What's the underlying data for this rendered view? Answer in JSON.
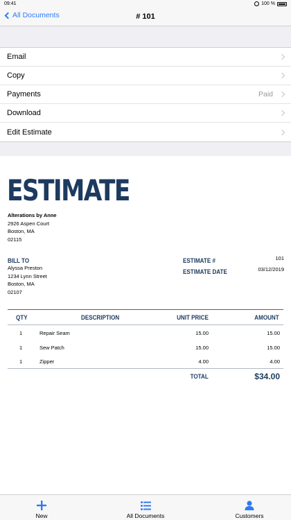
{
  "status_bar": {
    "time": "09:41",
    "battery": "100 %"
  },
  "nav": {
    "back_label": "All Documents",
    "title": "# 101"
  },
  "menu": [
    {
      "label": "Email",
      "value": ""
    },
    {
      "label": "Copy",
      "value": ""
    },
    {
      "label": "Payments",
      "value": "Paid"
    },
    {
      "label": "Download",
      "value": ""
    },
    {
      "label": "Edit Estimate",
      "value": ""
    }
  ],
  "document": {
    "title": "ESTIMATE",
    "company": {
      "name": "Alterations by Anne",
      "street": "2926 Aspen Court",
      "city": "Boston, MA",
      "zip": "02115"
    },
    "bill_to_label": "BILL TO",
    "bill_to": {
      "name": "Alyssa Preston",
      "street": "1234 Lynn Street",
      "city": "Boston, MA",
      "zip": "02107"
    },
    "estimate_num_label": "ESTIMATE #",
    "estimate_num": "101",
    "estimate_date_label": "ESTIMATE DATE",
    "estimate_date": "03/12/2019",
    "table": {
      "headers": {
        "qty": "QTY",
        "description": "DESCRIPTION",
        "unit_price": "UNIT PRICE",
        "amount": "AMOUNT"
      },
      "rows": [
        {
          "qty": "1",
          "description": "Repair Seam",
          "unit_price": "15.00",
          "amount": "15.00"
        },
        {
          "qty": "1",
          "description": "Sew Patch",
          "unit_price": "15.00",
          "amount": "15.00"
        },
        {
          "qty": "1",
          "description": "Zipper",
          "unit_price": "4.00",
          "amount": "4.00"
        }
      ],
      "total_label": "TOTAL",
      "total": "$34.00"
    }
  },
  "tabs": [
    {
      "label": "New",
      "icon": "plus-icon"
    },
    {
      "label": "All Documents",
      "icon": "list-icon"
    },
    {
      "label": "Customers",
      "icon": "person-icon"
    }
  ],
  "colors": {
    "accent": "#2f7bf6",
    "brand": "#1d3a5f",
    "rule": "#c0392b"
  }
}
